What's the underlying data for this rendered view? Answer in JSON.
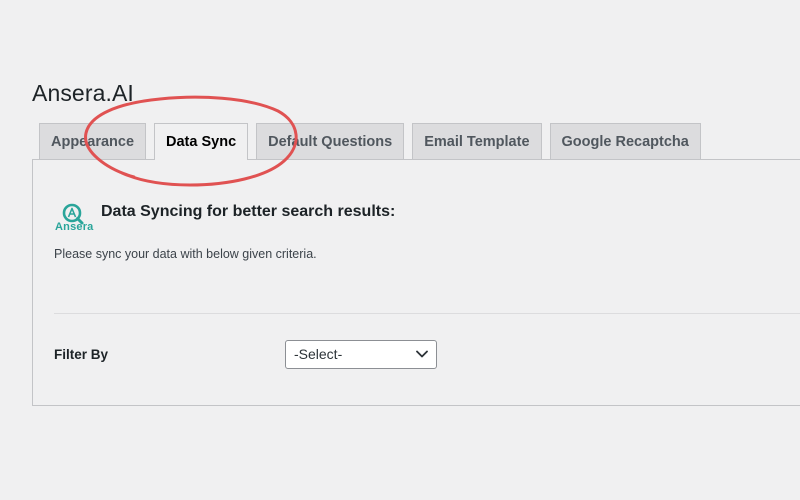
{
  "page": {
    "title": "Ansera.AI"
  },
  "tabs": [
    {
      "label": "Appearance",
      "active": false
    },
    {
      "label": "Data Sync",
      "active": true
    },
    {
      "label": "Default Questions",
      "active": false
    },
    {
      "label": "Email Template",
      "active": false
    },
    {
      "label": "Google Recaptcha",
      "active": false
    }
  ],
  "panel": {
    "logo_text": "Ansera",
    "heading": "Data Syncing for better search results:",
    "description": "Please sync your data with below given criteria.",
    "filter_label": "Filter By",
    "filter_select": {
      "selected": "-Select-"
    }
  },
  "colors": {
    "background": "#f0f0f1",
    "tab_inactive": "#dcdcde",
    "border": "#c3c4c7",
    "logo_accent": "#2aa59a",
    "annotation": "#e05252"
  },
  "icons": {
    "logo": "ansera-logo-icon",
    "select_arrow": "chevron-down-icon"
  }
}
